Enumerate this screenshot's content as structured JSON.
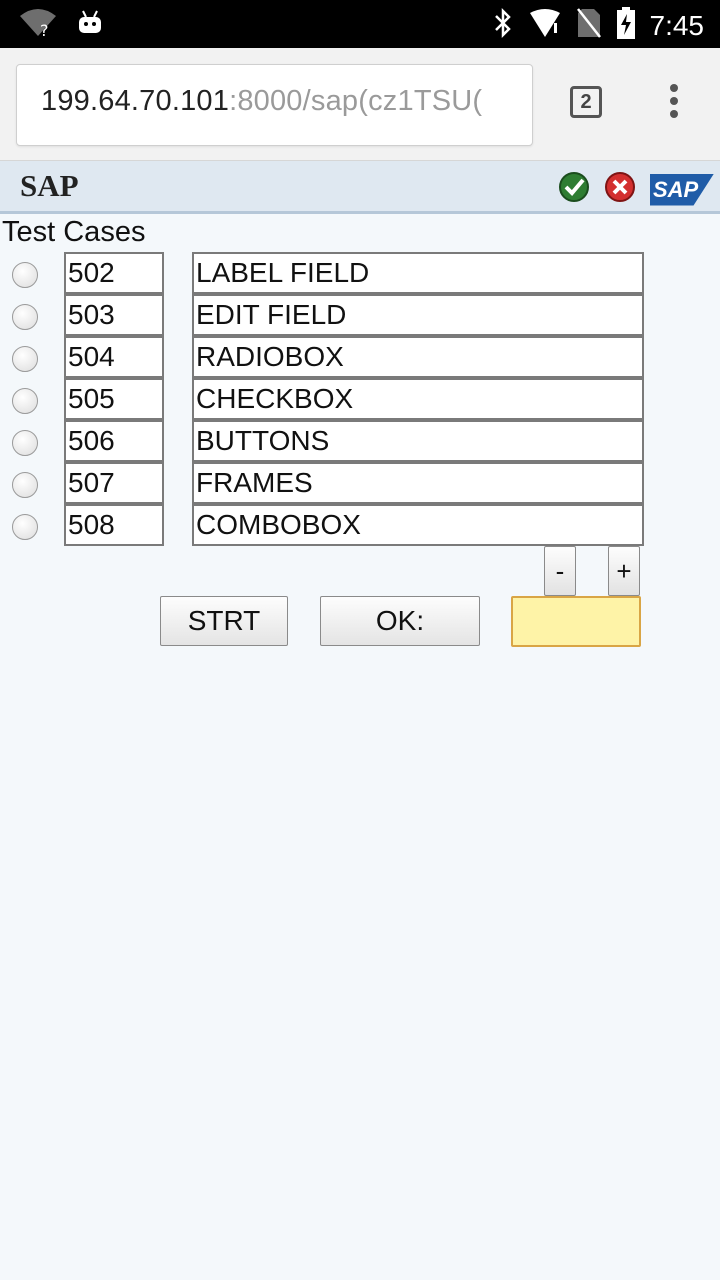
{
  "status_bar": {
    "time": "7:45",
    "icons": [
      "wifi-question-icon",
      "android-debug-icon",
      "bluetooth-icon",
      "signal-icon",
      "no-sim-icon",
      "battery-charging-icon"
    ]
  },
  "browser": {
    "url_host": "199.64.70.101",
    "url_rest": ":8000/sap(cz1TSU(",
    "tab_count": "2"
  },
  "sap_header": {
    "title": "SAP",
    "logo_text": "SAP"
  },
  "content": {
    "section_label": "Test Cases",
    "rows": [
      {
        "number": "502",
        "description": "LABEL FIELD"
      },
      {
        "number": "503",
        "description": "EDIT FIELD"
      },
      {
        "number": "504",
        "description": "RADIOBOX"
      },
      {
        "number": "505",
        "description": "CHECKBOX"
      },
      {
        "number": "506",
        "description": "BUTTONS"
      },
      {
        "number": "507",
        "description": "FRAMES"
      },
      {
        "number": "508",
        "description": "COMBOBOX"
      }
    ],
    "page_down_label": "-",
    "page_up_label": "+",
    "start_label": "STRT",
    "ok_label": "OK:",
    "command_value": ""
  },
  "colors": {
    "sap_bar": "#dfe8f1",
    "input_highlight": "#fef3a7",
    "sap_blue": "#1f5ca8"
  }
}
